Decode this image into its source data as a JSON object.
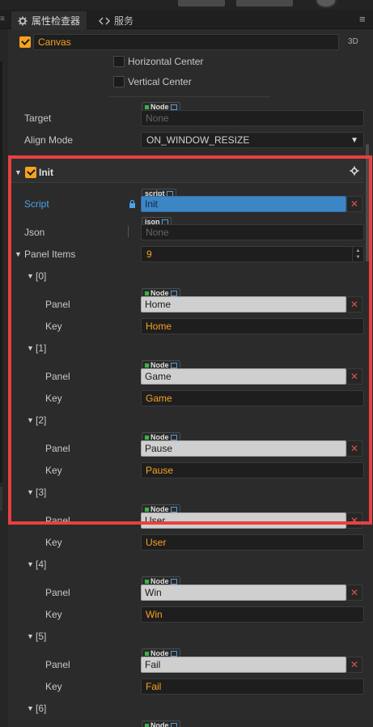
{
  "tabs": {
    "inspector": "属性检查器",
    "services": "服务"
  },
  "canvas": {
    "name": "Canvas",
    "badge": "3D"
  },
  "widget": {
    "horizontal_center": "Horizontal Center",
    "vertical_center": "Vertical Center"
  },
  "target": {
    "label": "Target",
    "tag": "Node",
    "value": "None"
  },
  "align_mode": {
    "label": "Align Mode",
    "value": "ON_WINDOW_RESIZE"
  },
  "component": {
    "name": "Init"
  },
  "script": {
    "label": "Script",
    "tag": "script",
    "value": "Init"
  },
  "json": {
    "label": "Json",
    "tag": "json",
    "value": "None"
  },
  "panel_items": {
    "label": "Panel Items",
    "count": "9"
  },
  "items": [
    {
      "index": "[0]",
      "panel_label": "Panel",
      "key_label": "Key",
      "tag": "Node",
      "panel": "Home",
      "key": "Home"
    },
    {
      "index": "[1]",
      "panel_label": "Panel",
      "key_label": "Key",
      "tag": "Node",
      "panel": "Game",
      "key": "Game"
    },
    {
      "index": "[2]",
      "panel_label": "Panel",
      "key_label": "Key",
      "tag": "Node",
      "panel": "Pause",
      "key": "Pause"
    },
    {
      "index": "[3]",
      "panel_label": "Panel",
      "key_label": "Key",
      "tag": "Node",
      "panel": "User",
      "key": "User"
    },
    {
      "index": "[4]",
      "panel_label": "Panel",
      "key_label": "Key",
      "tag": "Node",
      "panel": "Win",
      "key": "Win"
    },
    {
      "index": "[5]",
      "panel_label": "Panel",
      "key_label": "Key",
      "tag": "Node",
      "panel": "Fail",
      "key": "Fail"
    },
    {
      "index": "[6]",
      "tag": "Node"
    }
  ],
  "colors": {
    "accent": "#f6a21e",
    "script_blue": "#3d86c6",
    "highlight_red": "#e7413f",
    "remove_red": "#d9534f"
  }
}
